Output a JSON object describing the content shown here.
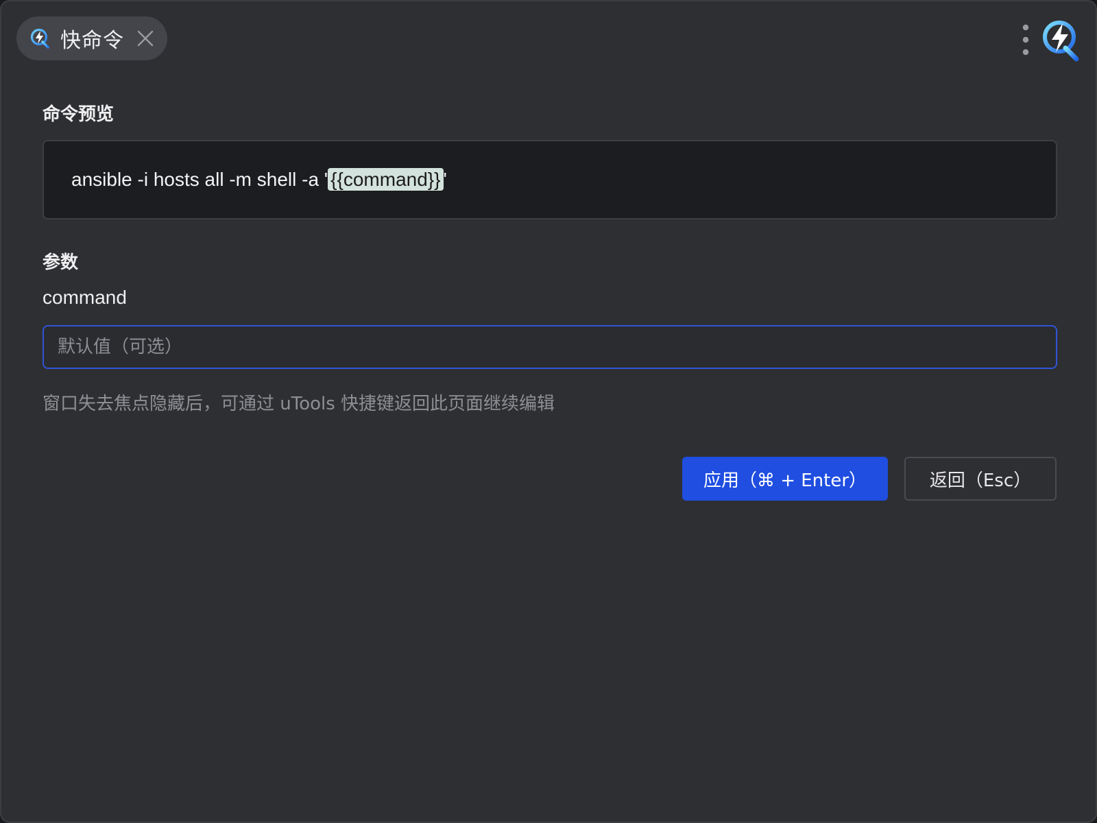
{
  "tab": {
    "label": "快命令",
    "icon": "quick-command-icon"
  },
  "header": {
    "more_icon": "more-vertical-icon",
    "logo_icon": "quick-command-logo-icon"
  },
  "preview": {
    "title": "命令预览",
    "command_prefix": "ansible -i hosts all -m shell -a '",
    "command_variable": "{{command}}",
    "command_suffix": "'"
  },
  "params": {
    "title": "参数",
    "items": [
      {
        "name": "command",
        "value": "",
        "placeholder": "默认值（可选）"
      }
    ]
  },
  "hint": "窗口失去焦点隐藏后，可通过 uTools 快捷键返回此页面继续编辑",
  "actions": {
    "apply_label": "应用（⌘ + Enter）",
    "back_label": "返回（Esc）"
  },
  "colors": {
    "accent": "#1f4ee0",
    "background": "#2e2f32",
    "variable_highlight": "#d3e2dc"
  }
}
